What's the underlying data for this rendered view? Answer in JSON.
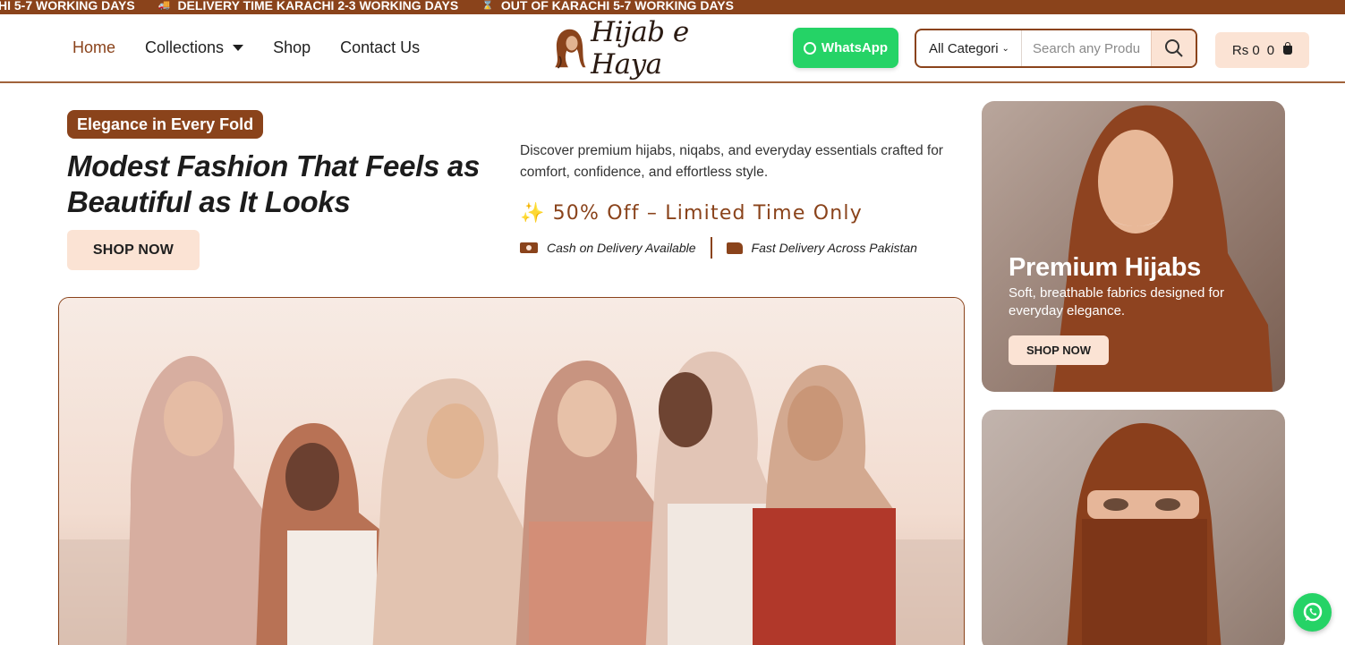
{
  "announcement": {
    "messages": [
      {
        "icon": "",
        "text": "HI 5-7 WORKING DAYS"
      },
      {
        "icon": "delivery-truck-icon",
        "text": "DELIVERY TIME KARACHI 2-3 WORKING DAYS"
      },
      {
        "icon": "hourglass-icon",
        "text": "OUT OF KARACHI 5-7 WORKING DAYS"
      }
    ]
  },
  "nav": {
    "home": "Home",
    "collections": "Collections",
    "shop": "Shop",
    "contact": "Contact Us"
  },
  "logo": {
    "text": "Hijab e Haya"
  },
  "whatsapp": {
    "label": "WhatsApp"
  },
  "search": {
    "category": "All Categori",
    "placeholder": "Search any Produ"
  },
  "cart": {
    "amount": "Rs 0",
    "count": "0"
  },
  "hero": {
    "badge": "Elegance in Every Fold",
    "headline_line1": "Modest Fashion That Feels as",
    "headline_line2": "Beautiful as It Looks",
    "shop_now": "SHOP NOW",
    "description": "Discover premium hijabs, niqabs, and everyday essentials crafted for comfort, confidence, and effortless style.",
    "promo": "50% Off – Limited Time Only",
    "perk_cod": "Cash on Delivery Available",
    "perk_delivery": "Fast Delivery Across Pakistan"
  },
  "card_premium": {
    "title": "Premium Hijabs",
    "subtitle": "Soft, breathable fabrics designed for everyday elegance.",
    "button": "SHOP NOW"
  },
  "colors": {
    "brand": "#8a431b",
    "peach": "#fbe3d4",
    "whatsapp": "#25d366"
  }
}
